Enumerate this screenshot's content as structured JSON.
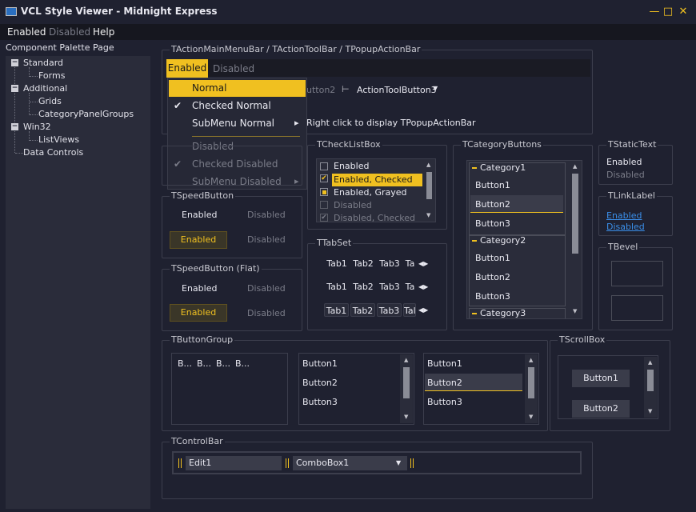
{
  "window": {
    "title": "VCL Style Viewer - Midnight Express",
    "min": "—",
    "max": "□",
    "close": "✕"
  },
  "menu": {
    "enabled": "Enabled",
    "disabled": "Disabled",
    "help": "Help"
  },
  "palette": {
    "title": "Component Palette Page",
    "items": [
      "Standard",
      "Forms",
      "Additional",
      "Grids",
      "CategoryPanelGroups",
      "Win32",
      "ListViews",
      "Data Controls"
    ],
    "box_minus": "−"
  },
  "action": {
    "group": "TActionMainMenuBar / TActionToolBar / TPopupActionBar",
    "enabled": "Enabled",
    "disabled": "Disabled",
    "btn2": "utton2",
    "btn3": "ActionToolButton3",
    "hint": "Right click to display TPopupActionBar"
  },
  "dropdown": {
    "items": [
      "Normal",
      "Checked Normal",
      "SubMenu Normal",
      "Disabled",
      "Checked Disabled",
      "SubMenu Disabled"
    ],
    "check": "✔",
    "submenu": "▸"
  },
  "speed": {
    "group": "TSpeedButton",
    "enabled": "Enabled",
    "disabled": "Disabled"
  },
  "speedflat": {
    "group": "TSpeedButton (Flat)",
    "enabled": "Enabled",
    "disabled": "Disabled"
  },
  "checklist": {
    "group": "TCheckListBox",
    "items": [
      "Enabled",
      "Enabled, Checked",
      "Enabled, Grayed",
      "Disabled",
      "Disabled, Checked"
    ]
  },
  "tabset": {
    "group": "TTabSet",
    "tabs": [
      "Tab1",
      "Tab2",
      "Tab3",
      "Ta"
    ],
    "tabs2": [
      "Tab1",
      "Tab2",
      "Tab3",
      "Ta"
    ],
    "tabs3": [
      "Tab1",
      "Tab2",
      "Tab3",
      "Tal"
    ]
  },
  "category": {
    "group": "TCategoryButtons",
    "cat1": "Category1",
    "cat2": "Category2",
    "cat3": "Category3",
    "b1": "Button1",
    "b2": "Button2",
    "b3": "Button3"
  },
  "static": {
    "group": "TStaticText",
    "enabled": "Enabled",
    "disabled": "Disabled"
  },
  "link": {
    "group": "TLinkLabel",
    "enabled": "Enabled",
    "disabled": "Disabled"
  },
  "bevel": {
    "group": "TBevel"
  },
  "buttongroup": {
    "group": "TButtonGroup",
    "items": [
      "B...",
      "B...",
      "B...",
      "B..."
    ],
    "list": [
      "Button1",
      "Button2",
      "Button3"
    ]
  },
  "scrollbox": {
    "group": "TScrollBox",
    "b1": "Button1",
    "b2": "Button2"
  },
  "controlbar": {
    "group": "TControlBar",
    "edit": "Edit1",
    "combo": "ComboBox1"
  },
  "colors": {
    "accent": "#f0c020",
    "bg": "#1f2130",
    "panel": "#2a2c3a"
  }
}
